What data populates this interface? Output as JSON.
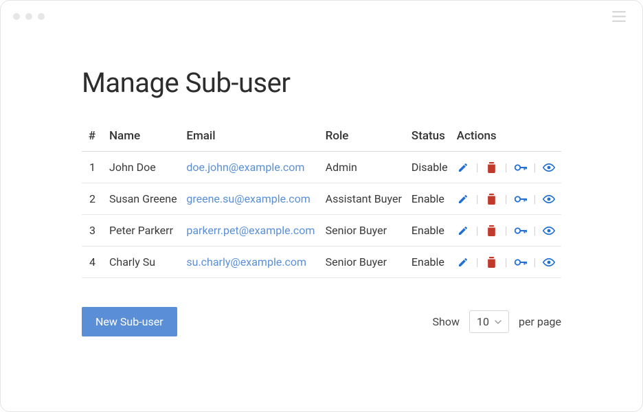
{
  "page": {
    "title": "Manage Sub-user"
  },
  "table": {
    "columns": {
      "idx": "#",
      "name": "Name",
      "email": "Email",
      "role": "Role",
      "status": "Status",
      "actions": "Actions"
    },
    "rows": [
      {
        "idx": "1",
        "name": "John Doe",
        "email": "doe.john@example.com",
        "role": "Admin",
        "status": "Disable"
      },
      {
        "idx": "2",
        "name": "Susan Greene",
        "email": "greene.su@example.com",
        "role": "Assistant Buyer",
        "status": "Enable"
      },
      {
        "idx": "3",
        "name": "Peter Parkerr",
        "email": "parkerr.pet@example.com",
        "role": "Senior Buyer",
        "status": "Enable"
      },
      {
        "idx": "4",
        "name": "Charly Su",
        "email": "su.charly@example.com",
        "role": "Senior Buyer",
        "status": "Enable"
      }
    ]
  },
  "actions": {
    "new_label": "New Sub-user"
  },
  "pager": {
    "show_label": "Show",
    "per_page_label": "per page",
    "value": "10"
  },
  "colors": {
    "link": "#5a8fd8",
    "primary": "#5a8fd8",
    "danger": "#c0392b"
  }
}
